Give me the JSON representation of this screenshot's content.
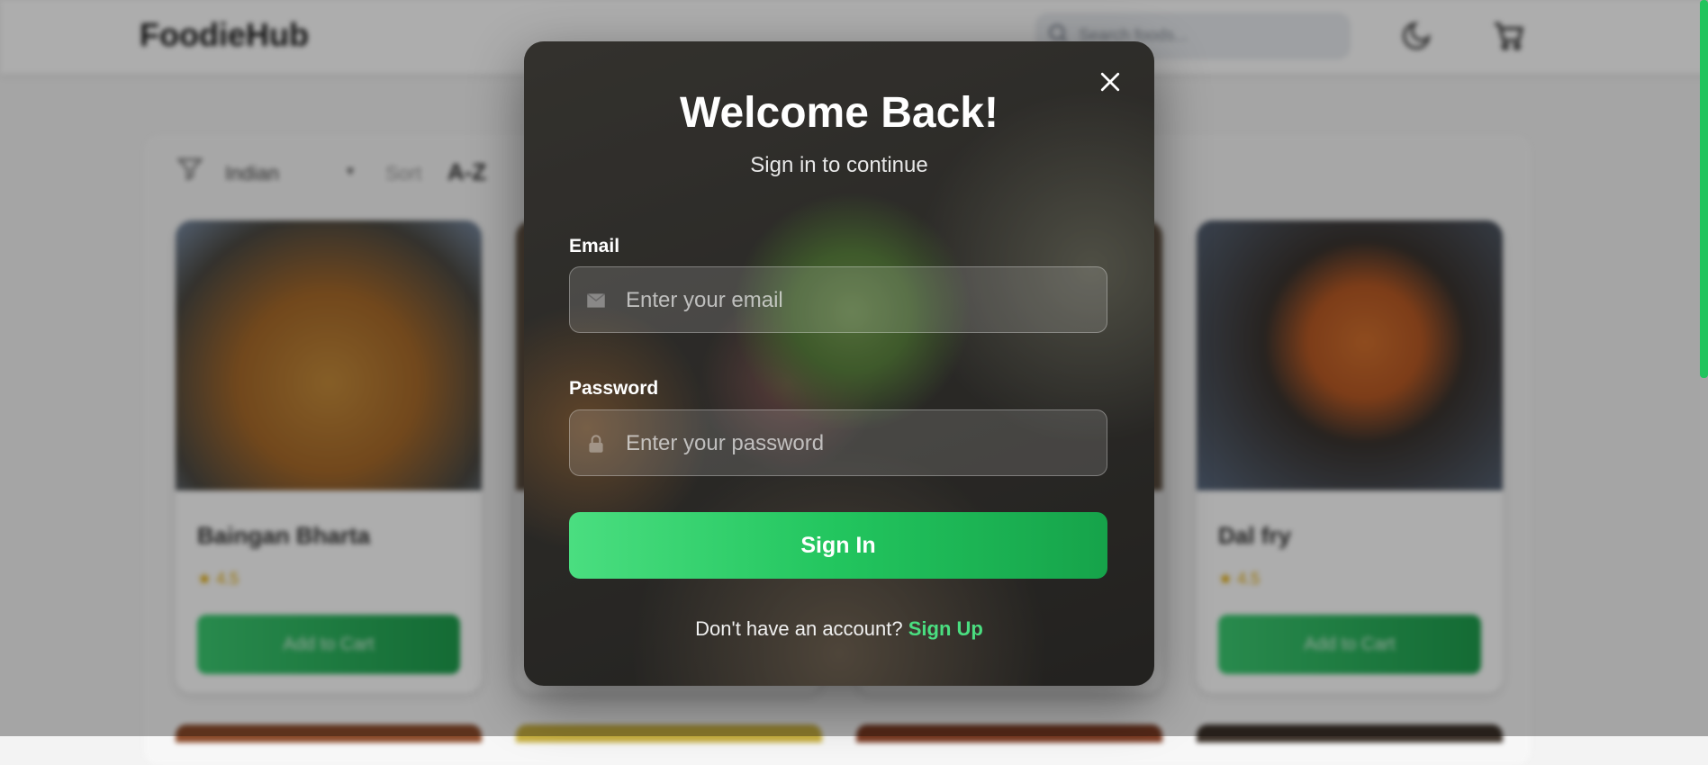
{
  "background": {
    "brand": "FoodieHub",
    "search_placeholder": "Search foods...",
    "filter": {
      "cuisine": "Indian",
      "sort_label": "Sort",
      "sort_value": "A-Z"
    },
    "cards": [
      {
        "name": "Baingan Bharta",
        "rating": "4.5",
        "button": "Add to Cart"
      },
      {
        "name": "",
        "rating": "",
        "button": ""
      },
      {
        "name": "",
        "rating": "",
        "button": ""
      },
      {
        "name": "Dal fry",
        "rating": "4.5",
        "button": "Add to Cart"
      }
    ]
  },
  "modal": {
    "title": "Welcome Back!",
    "subtitle": "Sign in to continue",
    "email_label": "Email",
    "email_placeholder": "Enter your email",
    "password_label": "Password",
    "password_placeholder": "Enter your password",
    "submit_label": "Sign In",
    "footer_text": "Don't have an account?",
    "footer_link": "Sign Up"
  },
  "icons": {
    "close": "close-icon",
    "email": "mail-icon",
    "password": "lock-icon",
    "search": "search-icon",
    "theme": "moon-icon",
    "cart": "cart-icon",
    "filter": "filter-icon"
  },
  "colors": {
    "accent": "#22c55e",
    "accent_light": "#4ade80",
    "rating": "#e0a800"
  }
}
